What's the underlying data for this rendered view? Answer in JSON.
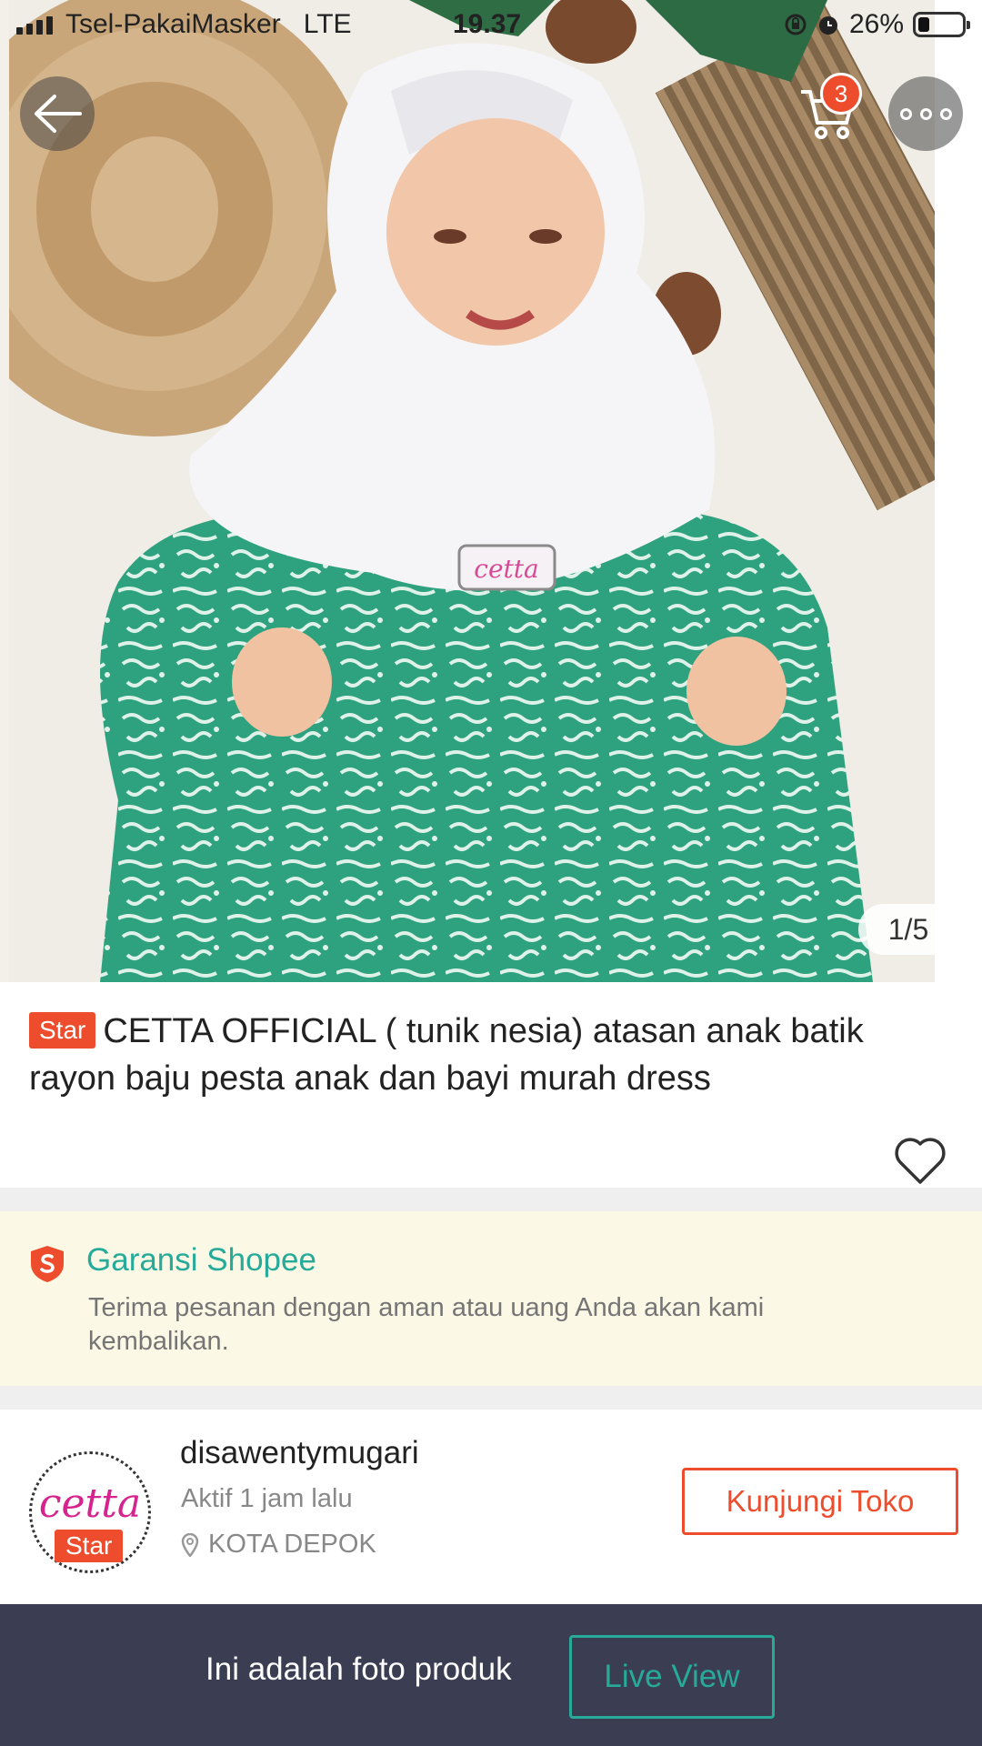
{
  "status_bar": {
    "carrier": "Tsel-PakaiMasker",
    "network": "LTE",
    "time": "19.37",
    "battery": "26%",
    "battery_level": 0.26
  },
  "top_nav": {
    "back_icon": "arrow-left-icon",
    "cart_icon": "cart-icon",
    "cart_badge": "3",
    "more_icon": "more-dots-icon"
  },
  "gallery": {
    "counter": "1/5",
    "image_label": "cetta"
  },
  "product": {
    "badge": "Star",
    "title": "CETTA OFFICIAL ( tunik nesia) atasan anak batik rayon baju pesta anak dan bayi murah dress",
    "favorite_icon": "heart-outline-icon"
  },
  "guarantee": {
    "icon": "shield-icon",
    "title": "Garansi Shopee",
    "description": "Terima pesanan dengan aman atau uang Anda akan kami kembalikan."
  },
  "shop": {
    "logo_text": "cetta",
    "badge": "Star",
    "name": "disawentymugari",
    "active": "Aktif 1 jam lalu",
    "location_icon": "location-pin-icon",
    "location": "KOTA DEPOK",
    "visit_label": "Kunjungi Toko"
  },
  "bottom_bar": {
    "text": "Ini adalah foto produk",
    "live_view_label": "Live View"
  },
  "colors": {
    "accent": "#ee4d2d",
    "teal": "#26aa99",
    "bottom_bar": "#3b3e53",
    "guarantee_bg": "#fbf8e6"
  }
}
